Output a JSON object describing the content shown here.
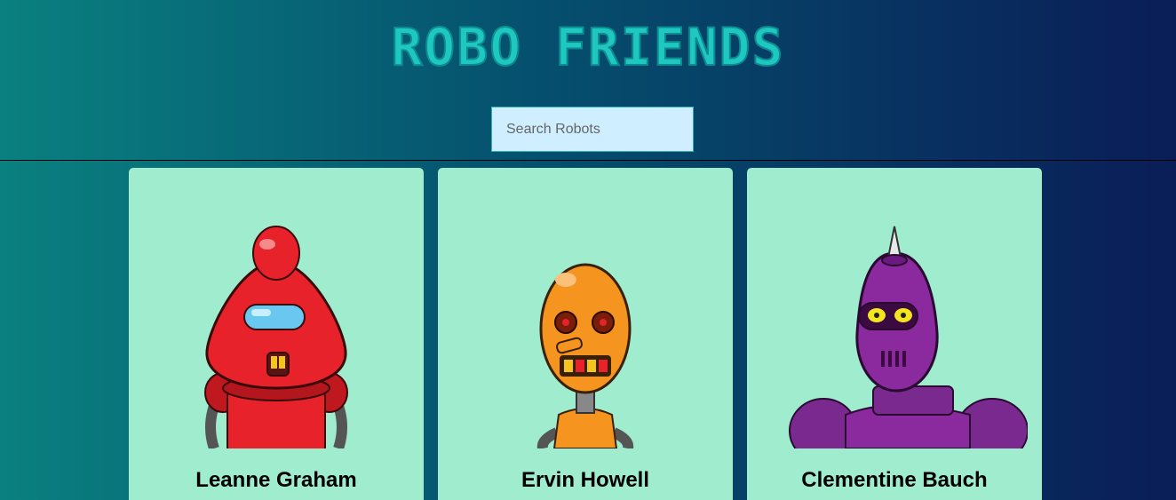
{
  "header": {
    "title": "ROBO FRIENDS"
  },
  "search": {
    "placeholder": "Search Robots"
  },
  "robots": [
    {
      "name": "Leanne Graham",
      "color": "#e8222a"
    },
    {
      "name": "Ervin Howell",
      "color": "#f5941e"
    },
    {
      "name": "Clementine Bauch",
      "color": "#8a2a9e"
    }
  ],
  "colors": {
    "card_bg": "#9feccf",
    "title": "#1ec8c0",
    "search_bg": "#cfeeff"
  }
}
